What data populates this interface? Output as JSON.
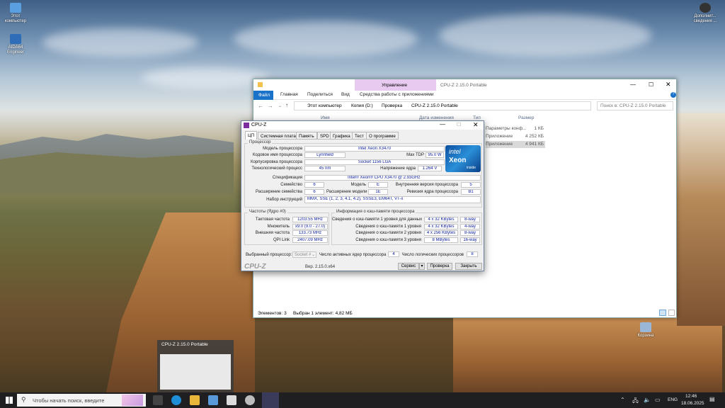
{
  "desktop": {
    "icons": [
      {
        "label": "Этот компьютер"
      },
      {
        "label": "AIDA64 Engineer"
      },
      {
        "label": "Дополнит... сведения ..."
      },
      {
        "label": "Корзина"
      }
    ],
    "thumbnail_title": "CPU-Z 2.15.0 Portable"
  },
  "explorer": {
    "title": "CPU-Z 2.15.0 Portable",
    "ribbon_context": "Управление",
    "ribbon_tabs": [
      "Файл",
      "Главная",
      "Поделиться",
      "Вид",
      "Средства работы с приложениями"
    ],
    "breadcrumb": [
      "Этот компьютер",
      "Копия (D:)",
      "Проверка",
      "CPU-Z 2.15.0 Portable"
    ],
    "search_placeholder": "Поиск в: CPU-Z 2.15.0 Portable",
    "columns": [
      "Имя",
      "Дата изменения",
      "Тип",
      "Размер"
    ],
    "rows": [
      {
        "type": "Параметры конф...",
        "size": "1 КБ"
      },
      {
        "type": "Приложение",
        "size": "4 252 КБ"
      },
      {
        "type": "Приложение",
        "size": "4 941 КБ"
      }
    ],
    "status_items": "Элементов: 3",
    "status_selected": "Выбран 1 элемент: 4,82 МБ"
  },
  "cpuz": {
    "title": "CPU-Z",
    "tabs": [
      "ЦП",
      "Системная плата",
      "Память",
      "SPD",
      "Графика",
      "Тест",
      "О программе"
    ],
    "processor_group": "Процессор",
    "labels": {
      "model": "Модель процессора",
      "codename": "Кодовое имя процессора",
      "maxtdp": "Max TDP",
      "package": "Корпусировка процессора",
      "technology": "Технологический процесс",
      "voltage": "Напряжение ядра",
      "spec": "Спецификация",
      "family": "Семейство",
      "model_num": "Модель",
      "stepping": "Внутренняя версия процессора",
      "ext_family": "Расширение семейства",
      "ext_model": "Расширение модели",
      "revision": "Ревизия ядра процессора",
      "instructions": "Набор инструкций"
    },
    "values": {
      "model": "Intel Xeon X3470",
      "codename": "Lynnfield",
      "maxtdp": "95.0 W",
      "package": "Socket 1156 LGA",
      "technology": "45 nm",
      "voltage": "1.264 V",
      "spec": "Intel® Xeon® CPU         X3470  @ 2.93GHz",
      "family": "6",
      "model_num": "E",
      "stepping": "5",
      "ext_family": "6",
      "ext_model": "1E",
      "revision": "B1",
      "instructions": "MMX, SSE (1, 2, 3, 4.1, 4.2), SSSE3, EM64T, VT-x"
    },
    "logo": {
      "brand": "intel",
      "product": "Xeon",
      "sub": "inside"
    },
    "clocks": {
      "group": "Частоты (Ядро #0)",
      "labels": [
        "Тактовая частота",
        "Множитель",
        "Внешняя частота",
        "QPI Link"
      ],
      "values": [
        "1203.55 MHz",
        "x9.0 (9.0 - 27.0)",
        "133.73 MHz",
        "2407.09 MHz"
      ]
    },
    "cache": {
      "group": "Информация о кэш-памяти процессора",
      "labels": [
        "Сведения о кэш-памяти 1 уровня для данных",
        "Сведения о кэш-памяти 1 уровня",
        "Сведения о кэш-памяти 2 уровня",
        "Сведения о кэш-памяти 3 уровня"
      ],
      "sizes": [
        "4 x 32 KBytes",
        "4 x 32 KBytes",
        "4 x 256 KBytes",
        "8 MBytes"
      ],
      "ways": [
        "8-way",
        "4-way",
        "8-way",
        "16-way"
      ]
    },
    "selection": {
      "label": "Выбранный процессор:",
      "socket": "Socket #",
      "active_cores_label": "Число активных ядер процессора",
      "active_cores": "4",
      "threads_label": "Число логических процессоров",
      "threads": "8"
    },
    "footer": {
      "brand": "CPU-Z",
      "version": "Вер. 2.15.0.x64",
      "service": "Сервис",
      "validate": "Проверка",
      "close": "Закрыть"
    }
  },
  "taskbar": {
    "search_placeholder": "Чтобы начать поиск, введите",
    "lang": "ENG",
    "time": "12:46",
    "date": "18.06.2025"
  }
}
